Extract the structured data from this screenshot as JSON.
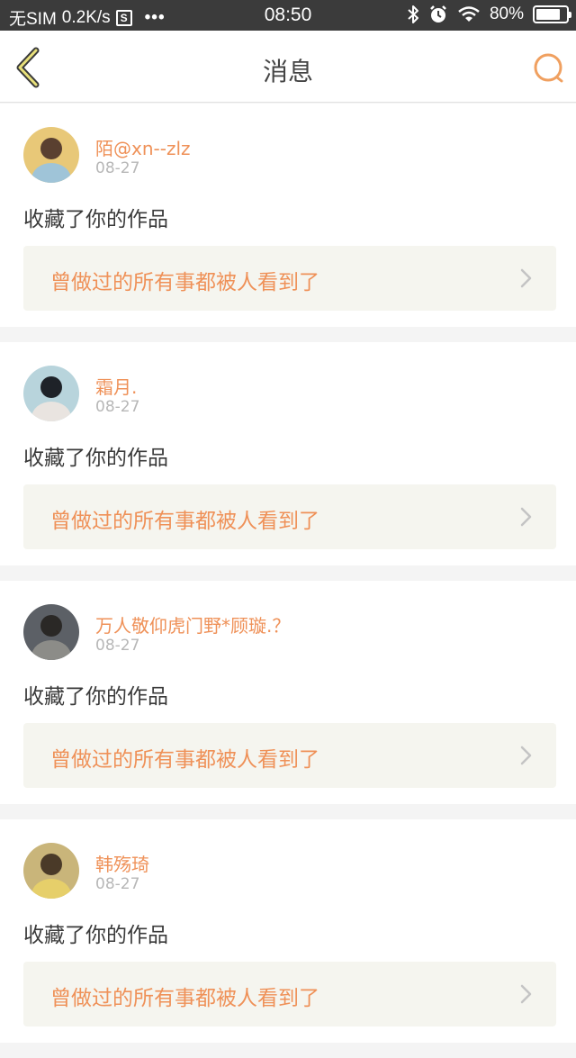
{
  "status_bar": {
    "carrier": "无SIM",
    "speed": "0.2K/s",
    "notification_icon_letter": "S",
    "more_dots": "•••",
    "time": "08:50",
    "battery_percent": "80%",
    "battery_level": 0.8
  },
  "nav": {
    "title": "消息",
    "accent_color": "#f0a060"
  },
  "messages": [
    {
      "username": "陌@xn--zlz",
      "date": "08-27",
      "action": "收藏了你的作品",
      "work_title": "曾做过的所有事都被人看到了",
      "avatar": "user-avatar-photo"
    },
    {
      "username": "霜月.",
      "date": "08-27",
      "action": "收藏了你的作品",
      "work_title": "曾做过的所有事都被人看到了",
      "avatar": "user-avatar-photo"
    },
    {
      "username": "万人敬仰虎门野*顾璇.？",
      "date": "08-27",
      "action": "收藏了你的作品",
      "work_title": "曾做过的所有事都被人看到了",
      "avatar": "user-avatar-photo"
    },
    {
      "username": "韩殇琦",
      "date": "08-27",
      "action": "收藏了你的作品",
      "work_title": "曾做过的所有事都被人看到了",
      "avatar": "user-avatar-photo"
    }
  ]
}
